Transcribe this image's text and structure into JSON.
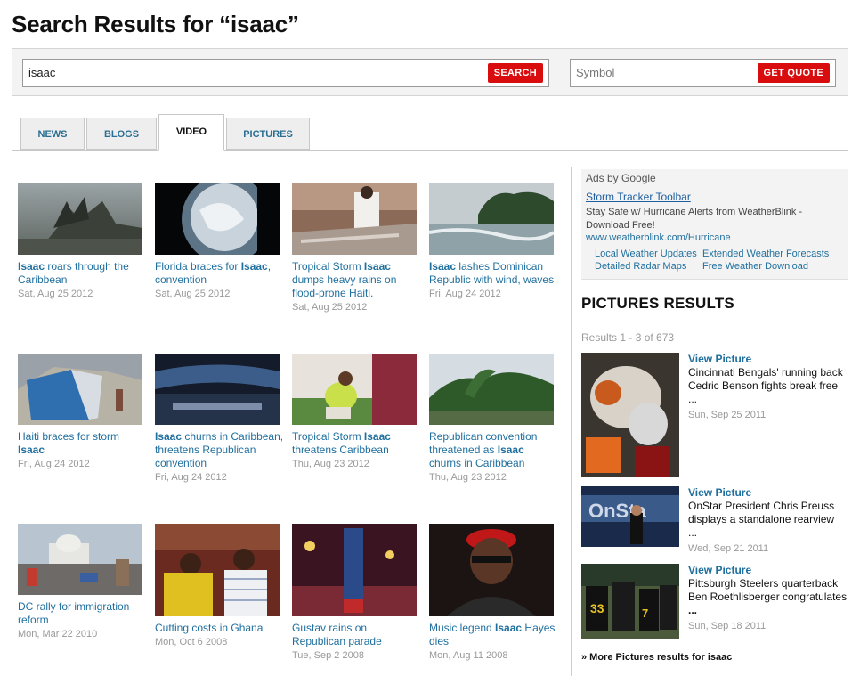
{
  "page": {
    "title": "Search Results for “isaac”"
  },
  "search": {
    "value": "isaac",
    "button": "SEARCH"
  },
  "quote": {
    "placeholder": "Symbol",
    "button": "GET QUOTE"
  },
  "tabs": [
    {
      "label": "NEWS",
      "active": false
    },
    {
      "label": "BLOGS",
      "active": false
    },
    {
      "label": "VIDEO",
      "active": true
    },
    {
      "label": "PICTURES",
      "active": false
    }
  ],
  "videos": [
    {
      "pre": "",
      "bold": "Isaac",
      "post": " roars through the Caribbean",
      "date": "Sat, Aug 25 2012"
    },
    {
      "pre": "Florida braces for ",
      "bold": "Isaac",
      "post": ", convention",
      "date": "Sat, Aug 25 2012"
    },
    {
      "pre": "Tropical Storm ",
      "bold": "Isaac",
      "post": " dumps heavy rains on flood-prone Haiti.",
      "date": "Sat, Aug 25 2012"
    },
    {
      "pre": "",
      "bold": "Isaac",
      "post": " lashes Dominican Republic with wind, waves",
      "date": "Fri, Aug 24 2012"
    },
    {
      "pre": "Haiti braces for storm ",
      "bold": "Isaac",
      "post": "",
      "date": "Fri, Aug 24 2012"
    },
    {
      "pre": "",
      "bold": "Isaac",
      "post": " churns in Caribbean, threatens Republican convention",
      "date": "Fri, Aug 24 2012"
    },
    {
      "pre": "Tropical Storm ",
      "bold": "Isaac",
      "post": " threatens Caribbean",
      "date": "Thu, Aug 23 2012"
    },
    {
      "pre": "Republican convention threatened as ",
      "bold": "Isaac",
      "post": " churns in Caribbean",
      "date": "Thu, Aug 23 2012"
    },
    {
      "pre": "DC rally for immigration reform",
      "bold": "",
      "post": "",
      "date": "Mon, Mar 22 2010"
    },
    {
      "pre": "Cutting costs in Ghana",
      "bold": "",
      "post": "",
      "date": "Mon, Oct 6 2008"
    },
    {
      "pre": "Gustav rains on Republican parade",
      "bold": "",
      "post": "",
      "date": "Tue, Sep 2 2008"
    },
    {
      "pre": "Music legend ",
      "bold": "Isaac",
      "post": " Hayes dies",
      "date": "Mon, Aug 11 2008"
    }
  ],
  "ads": {
    "title": "Ads by Google",
    "link": "Storm Tracker Toolbar",
    "text": "Stay Safe w/ Hurricane Alerts from WeatherBlink - Download Free!",
    "url": "www.weatherblink.com/Hurricane",
    "sublinks": [
      "Local Weather Updates",
      "Extended Weather Forecasts",
      "Detailed Radar Maps",
      "Free Weather Download"
    ]
  },
  "pictures": {
    "title": "PICTURES RESULTS",
    "count_label": "Results",
    "count_range": "1 - 3 of 673",
    "items": [
      {
        "link": "View Picture",
        "caption": "Cincinnati Bengals' running back Cedric Benson fights break free",
        "ellipsis": "...",
        "date": "Sun, Sep 25 2011"
      },
      {
        "link": "View Picture",
        "caption": "OnStar President Chris Preuss displays a standalone rearview",
        "ellipsis": "...",
        "date": "Wed, Sep 21 2011"
      },
      {
        "link": "View Picture",
        "caption": "Pittsburgh Steelers quarterback Ben Roethlisberger congratulates",
        "ellipsis": "...",
        "date": "Sun, Sep 18 2011"
      }
    ],
    "more": "» More Pictures results for isaac"
  },
  "colors": {
    "accent": "#d90d0d",
    "link": "#1f6f9e"
  }
}
